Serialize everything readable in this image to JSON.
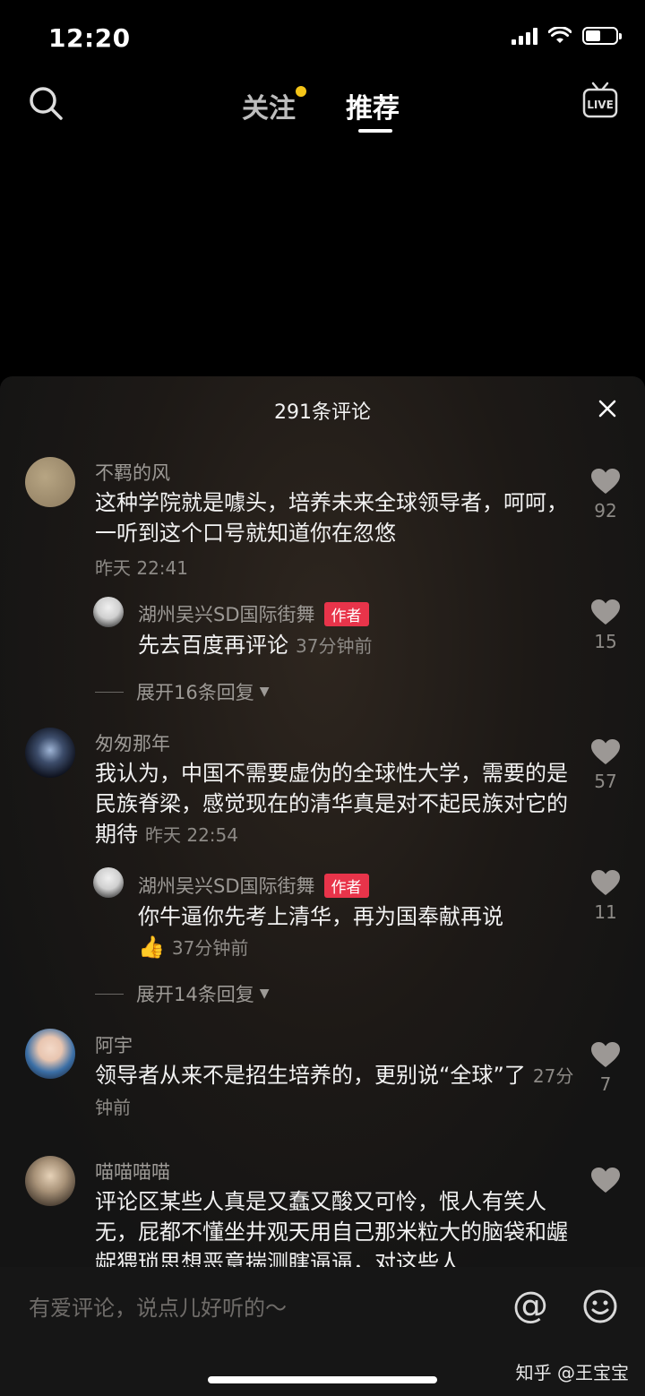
{
  "status_bar": {
    "time": "12:20"
  },
  "nav": {
    "tab_follow": "关注",
    "tab_recommend": "推荐",
    "live_icon": "live-icon",
    "search_icon": "search-icon"
  },
  "sheet": {
    "title": "291条评论"
  },
  "comments": [
    {
      "user": "不羁的风",
      "text": "这种学院就是噱头，培养未来全球领导者，呵呵，一听到这个口号就知道你在忽悠",
      "time": "昨天 22:41",
      "likes": "92",
      "reply": {
        "user": "湖州吴兴SD国际街舞",
        "badge": "作者",
        "text": "先去百度再评论",
        "time": "37分钟前",
        "likes": "15"
      },
      "expand": "展开16条回复"
    },
    {
      "user": "匆匆那年",
      "text": "我认为，中国不需要虚伪的全球性大学，需要的是民族脊梁，感觉现在的清华真是对不起民族对它的期待",
      "time": "昨天 22:54",
      "likes": "57",
      "reply": {
        "user": "湖州吴兴SD国际街舞",
        "badge": "作者",
        "text": "你牛逼你先考上清华，再为国奉献再说",
        "emoji": "👍",
        "time": "37分钟前",
        "likes": "11"
      },
      "expand": "展开14条回复"
    },
    {
      "user": "阿宇",
      "text": "领导者从来不是招生培养的，更别说“全球”了",
      "time": "27分钟前",
      "likes": "7"
    },
    {
      "user": "喵喵喵喵",
      "text": "评论区某些人真是又蠢又酸又可怜，恨人有笑人无，屁都不懂坐井观天用自己那米粒大的脑袋和龌龊猥琐思想恶意揣测瞎逼逼，对这些人"
    }
  ],
  "input": {
    "placeholder": "有爱评论，说点儿好听的～",
    "at": "@"
  },
  "watermark": "知乎 @王宝宝",
  "colors": {
    "badge": "#e8344a",
    "follow_dot": "#f5c518"
  }
}
